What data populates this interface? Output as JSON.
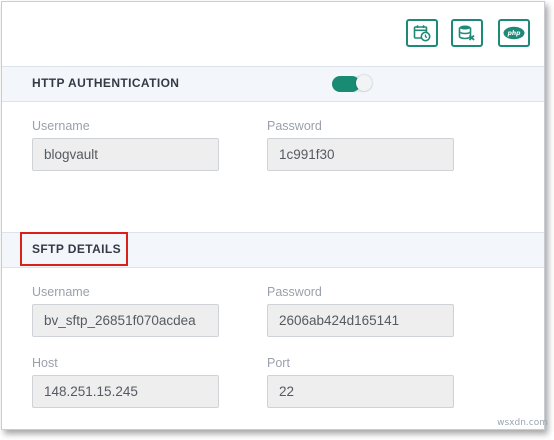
{
  "toolbar": {
    "buttons": [
      {
        "name": "schedule-calendar-icon"
      },
      {
        "name": "database-remove-icon"
      },
      {
        "name": "php-icon",
        "label": "php"
      }
    ],
    "accent_color": "#1d8a77"
  },
  "http_auth": {
    "title": "HTTP AUTHENTICATION",
    "toggle_on": true,
    "username_label": "Username",
    "username_value": "blogvault",
    "password_label": "Password",
    "password_value": "1c991f30"
  },
  "sftp": {
    "title": "SFTP DETAILS",
    "username_label": "Username",
    "username_value": "bv_sftp_26851f070acdea",
    "password_label": "Password",
    "password_value": "2606ab424d165141",
    "host_label": "Host",
    "host_value": "148.251.15.245",
    "port_label": "Port",
    "port_value": "22"
  },
  "watermark": "wsxdn.com",
  "highlight_color": "#d9201b"
}
